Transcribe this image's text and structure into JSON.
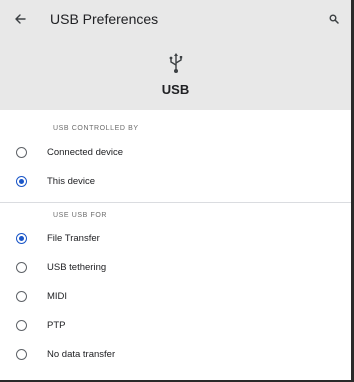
{
  "header": {
    "title": "USB Preferences",
    "back_icon": "arrow-left-icon",
    "search_icon": "search-icon",
    "hero_icon": "usb-icon",
    "hero_label": "USB"
  },
  "controlled_by": {
    "title": "USB CONTROLLED BY",
    "options": [
      {
        "label": "Connected device",
        "checked": false
      },
      {
        "label": "This device",
        "checked": true
      }
    ]
  },
  "use_for": {
    "title": "USE USB FOR",
    "options": [
      {
        "label": "File Transfer",
        "checked": true
      },
      {
        "label": "USB tethering",
        "checked": false
      },
      {
        "label": "MIDI",
        "checked": false
      },
      {
        "label": "PTP",
        "checked": false
      },
      {
        "label": "No data transfer",
        "checked": false
      }
    ]
  },
  "colors": {
    "header_bg": "#e8e8e8",
    "accent": "#1a56c8",
    "divider": "#dadce0"
  }
}
